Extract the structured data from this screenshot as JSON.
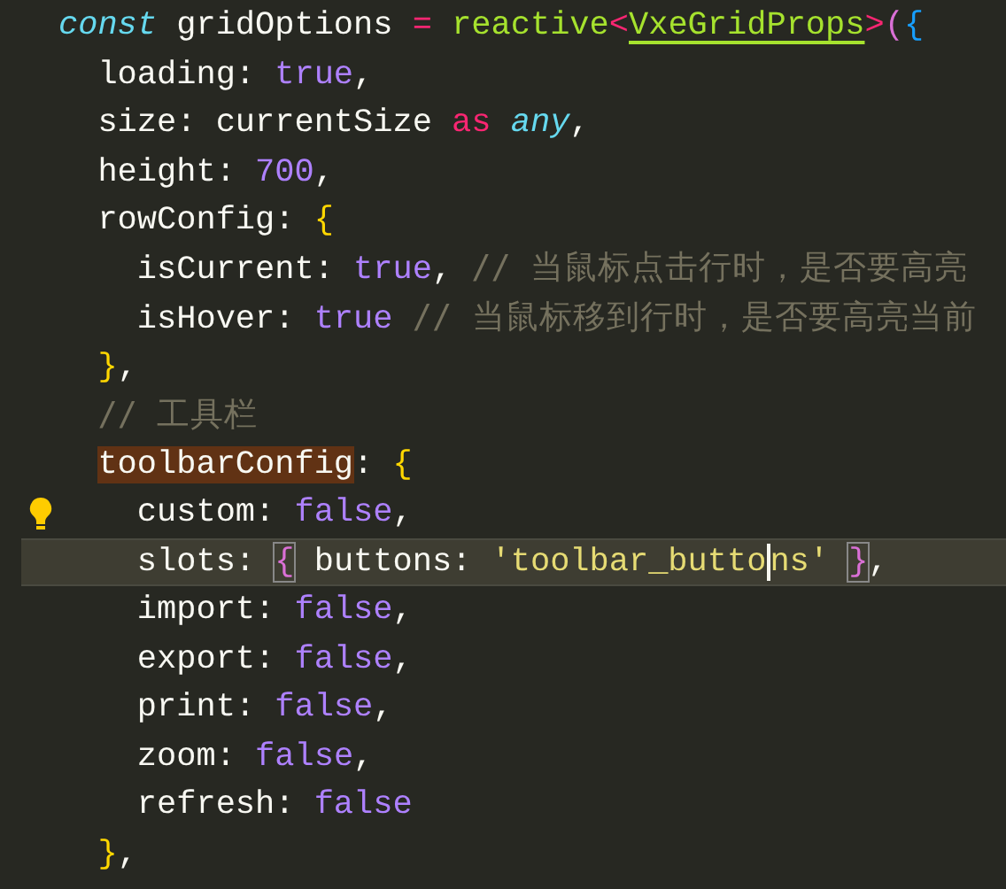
{
  "editor": {
    "lines": [
      {
        "current": false,
        "lightbulb": false,
        "tokens": [
          {
            "text": "const",
            "kind": "keyword"
          },
          {
            "text": " gridOptions ",
            "kind": "plain"
          },
          {
            "text": "= ",
            "kind": "operator"
          },
          {
            "text": "reactive",
            "kind": "function"
          },
          {
            "text": "<",
            "kind": "operator"
          },
          {
            "text": "VxeGridProps",
            "kind": "type_ref"
          },
          {
            "text": ">",
            "kind": "operator"
          },
          {
            "text": "(",
            "kind": "bracket2"
          },
          {
            "text": "{",
            "kind": "bracket3"
          }
        ],
        "children": [
          {
            "current": false,
            "lightbulb": false,
            "tokens": [
              {
                "text": "loading: ",
                "kind": "plain"
              },
              {
                "text": "true",
                "kind": "constant"
              },
              {
                "text": ",",
                "kind": "plain"
              }
            ]
          },
          {
            "current": false,
            "lightbulb": false,
            "tokens": [
              {
                "text": "size: currentSize ",
                "kind": "plain"
              },
              {
                "text": "as ",
                "kind": "operator"
              },
              {
                "text": "any",
                "kind": "keyword"
              },
              {
                "text": ",",
                "kind": "plain"
              }
            ]
          },
          {
            "current": false,
            "lightbulb": false,
            "tokens": [
              {
                "text": "height: ",
                "kind": "plain"
              },
              {
                "text": "700",
                "kind": "constant"
              },
              {
                "text": ",",
                "kind": "plain"
              }
            ]
          },
          {
            "current": false,
            "lightbulb": false,
            "tokens": [
              {
                "text": "rowConfig: ",
                "kind": "plain"
              },
              {
                "text": "{",
                "kind": "bracket1"
              }
            ],
            "children": [
              {
                "current": false,
                "lightbulb": false,
                "tokens": [
                  {
                    "text": "isCurrent: ",
                    "kind": "plain"
                  },
                  {
                    "text": "true",
                    "kind": "constant"
                  },
                  {
                    "text": ", ",
                    "kind": "plain"
                  },
                  {
                    "text": "// 当鼠标点击行时，是否要高亮",
                    "kind": "comment"
                  }
                ]
              },
              {
                "current": false,
                "lightbulb": false,
                "tokens": [
                  {
                    "text": "isHover: ",
                    "kind": "plain"
                  },
                  {
                    "text": "true ",
                    "kind": "constant"
                  },
                  {
                    "text": "// 当鼠标移到行时，是否要高亮当前",
                    "kind": "comment"
                  }
                ]
              }
            ]
          },
          {
            "current": false,
            "lightbulb": false,
            "tokens": [
              {
                "text": "}",
                "kind": "bracket1"
              },
              {
                "text": ",",
                "kind": "plain"
              }
            ]
          },
          {
            "current": false,
            "lightbulb": false,
            "tokens": [
              {
                "text": "// 工具栏",
                "kind": "comment"
              }
            ]
          },
          {
            "current": false,
            "lightbulb": false,
            "tokens": [
              {
                "text": "toolbarConfig",
                "kind": "occurrence"
              },
              {
                "text": ": ",
                "kind": "plain"
              },
              {
                "text": "{",
                "kind": "bracket1"
              }
            ],
            "children": [
              {
                "current": false,
                "lightbulb": true,
                "tokens": [
                  {
                    "text": "custom: ",
                    "kind": "plain"
                  },
                  {
                    "text": "false",
                    "kind": "constant"
                  },
                  {
                    "text": ",",
                    "kind": "plain"
                  }
                ]
              },
              {
                "current": true,
                "lightbulb": false,
                "tokens": [
                  {
                    "text": "slots: ",
                    "kind": "plain"
                  },
                  {
                    "text": "{",
                    "kind": "bracket_match"
                  },
                  {
                    "text": " buttons: ",
                    "kind": "plain"
                  },
                  {
                    "text": "'toolbar_butto",
                    "kind": "string"
                  },
                  {
                    "text": "ns' ",
                    "kind": "string_after_cursor"
                  },
                  {
                    "text": "}",
                    "kind": "bracket_match"
                  },
                  {
                    "text": ",",
                    "kind": "plain"
                  }
                ]
              },
              {
                "current": false,
                "lightbulb": false,
                "tokens": [
                  {
                    "text": "import: ",
                    "kind": "plain"
                  },
                  {
                    "text": "false",
                    "kind": "constant"
                  },
                  {
                    "text": ",",
                    "kind": "plain"
                  }
                ]
              },
              {
                "current": false,
                "lightbulb": false,
                "tokens": [
                  {
                    "text": "export: ",
                    "kind": "plain"
                  },
                  {
                    "text": "false",
                    "kind": "constant"
                  },
                  {
                    "text": ",",
                    "kind": "plain"
                  }
                ]
              },
              {
                "current": false,
                "lightbulb": false,
                "tokens": [
                  {
                    "text": "print: ",
                    "kind": "plain"
                  },
                  {
                    "text": "false",
                    "kind": "constant"
                  },
                  {
                    "text": ",",
                    "kind": "plain"
                  }
                ]
              },
              {
                "current": false,
                "lightbulb": false,
                "tokens": [
                  {
                    "text": "zoom: ",
                    "kind": "plain"
                  },
                  {
                    "text": "false",
                    "kind": "constant"
                  },
                  {
                    "text": ",",
                    "kind": "plain"
                  }
                ]
              },
              {
                "current": false,
                "lightbulb": false,
                "tokens": [
                  {
                    "text": "refresh: ",
                    "kind": "plain"
                  },
                  {
                    "text": "false",
                    "kind": "constant"
                  }
                ]
              }
            ]
          },
          {
            "current": false,
            "lightbulb": false,
            "tokens": [
              {
                "text": "}",
                "kind": "bracket1"
              },
              {
                "text": ",",
                "kind": "plain"
              }
            ]
          }
        ]
      }
    ]
  }
}
